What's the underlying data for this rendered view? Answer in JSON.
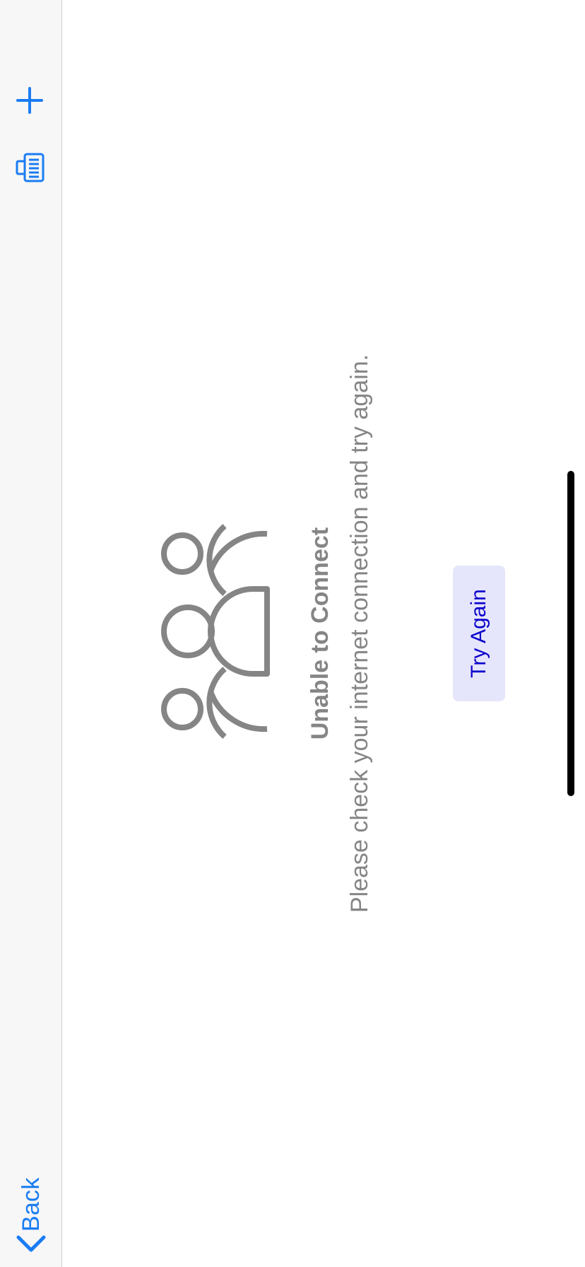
{
  "nav": {
    "back_label": "Back",
    "back_icon": "chevron-left-icon",
    "compose_icon": "compose-list-icon",
    "add_icon": "plus-icon"
  },
  "error": {
    "icon": "groups-icon",
    "title": "Unable to Connect",
    "message": "Please check your internet connection and try again.",
    "retry_label": "Try Again"
  },
  "colors": {
    "accent": "#1a7cf3",
    "nav_background": "#f7f7f7",
    "muted_text": "#858585",
    "button_background": "#e5e5fb",
    "button_text": "#0b00cc"
  }
}
